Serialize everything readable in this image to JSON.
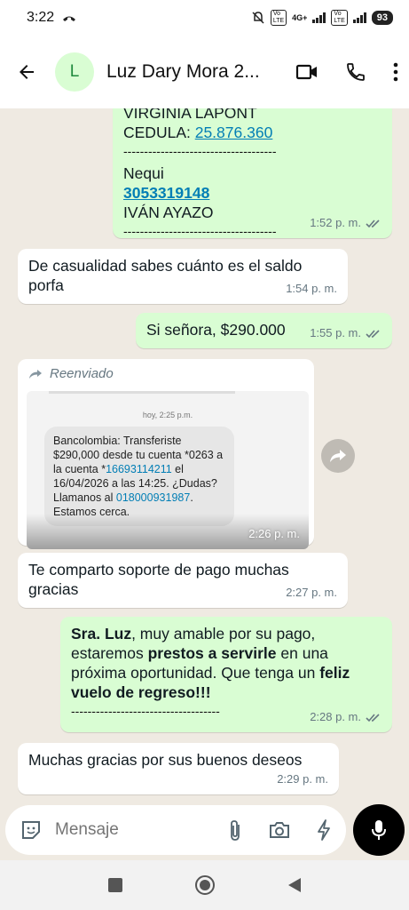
{
  "status_bar": {
    "time": "3:22",
    "battery": "93",
    "net": "4G+"
  },
  "header": {
    "avatar_letter": "L",
    "contact_name": "Luz Dary Mora 2..."
  },
  "messages": {
    "m1": {
      "top_line": "VIRGINIA LAPONT",
      "cedula_label": "CEDULA: ",
      "cedula_value": "25.876.360",
      "divider1": "-------------------------------------",
      "nequi_label": "Nequi",
      "nequi_value": "3053319148",
      "name": "IVÁN AYAZO",
      "divider2": "-------------------------------------",
      "time": "1:52 p. m."
    },
    "m2": {
      "text": "De casualidad sabes cuánto es el saldo porfa",
      "time": "1:54 p. m."
    },
    "m3": {
      "text": "Si señora, $290.000",
      "time": "1:55 p. m."
    },
    "m4": {
      "forwarded_label": "Reenviado",
      "shot_stamp": "hoy, 2:25 p.m.",
      "sms_p1": "Bancolombia: Transferiste $290,000 desde tu cuenta *0263 a la cuenta *",
      "sms_account": "16693114211",
      "sms_p2": " el 16/04/2026 a las 14:25. ¿Dudas? Llamanos al ",
      "sms_phone": "018000931987",
      "sms_p3": ". Estamos cerca.",
      "time": "2:26 p. m."
    },
    "m5": {
      "text": "Te comparto soporte de pago muchas gracias",
      "time": "2:27 p. m."
    },
    "m6": {
      "b1": "Sra. Luz",
      "t1": ", muy amable por su pago, estaremos ",
      "b2": "prestos a servirle",
      "t2": " en una próxima oportunidad. Que tenga un ",
      "b3": "feliz vuelo de regreso!!!",
      "divider": "------------------------------------",
      "time": "2:28 p. m."
    },
    "m7": {
      "text": "Muchas gracias por sus buenos deseos",
      "time": "2:29 p. m."
    }
  },
  "composer": {
    "placeholder": "Mensaje"
  },
  "colors": {
    "outgoing": "#d9fdd3",
    "incoming": "#ffffff",
    "wallpaper": "#efeae2",
    "link": "#027eb5"
  }
}
